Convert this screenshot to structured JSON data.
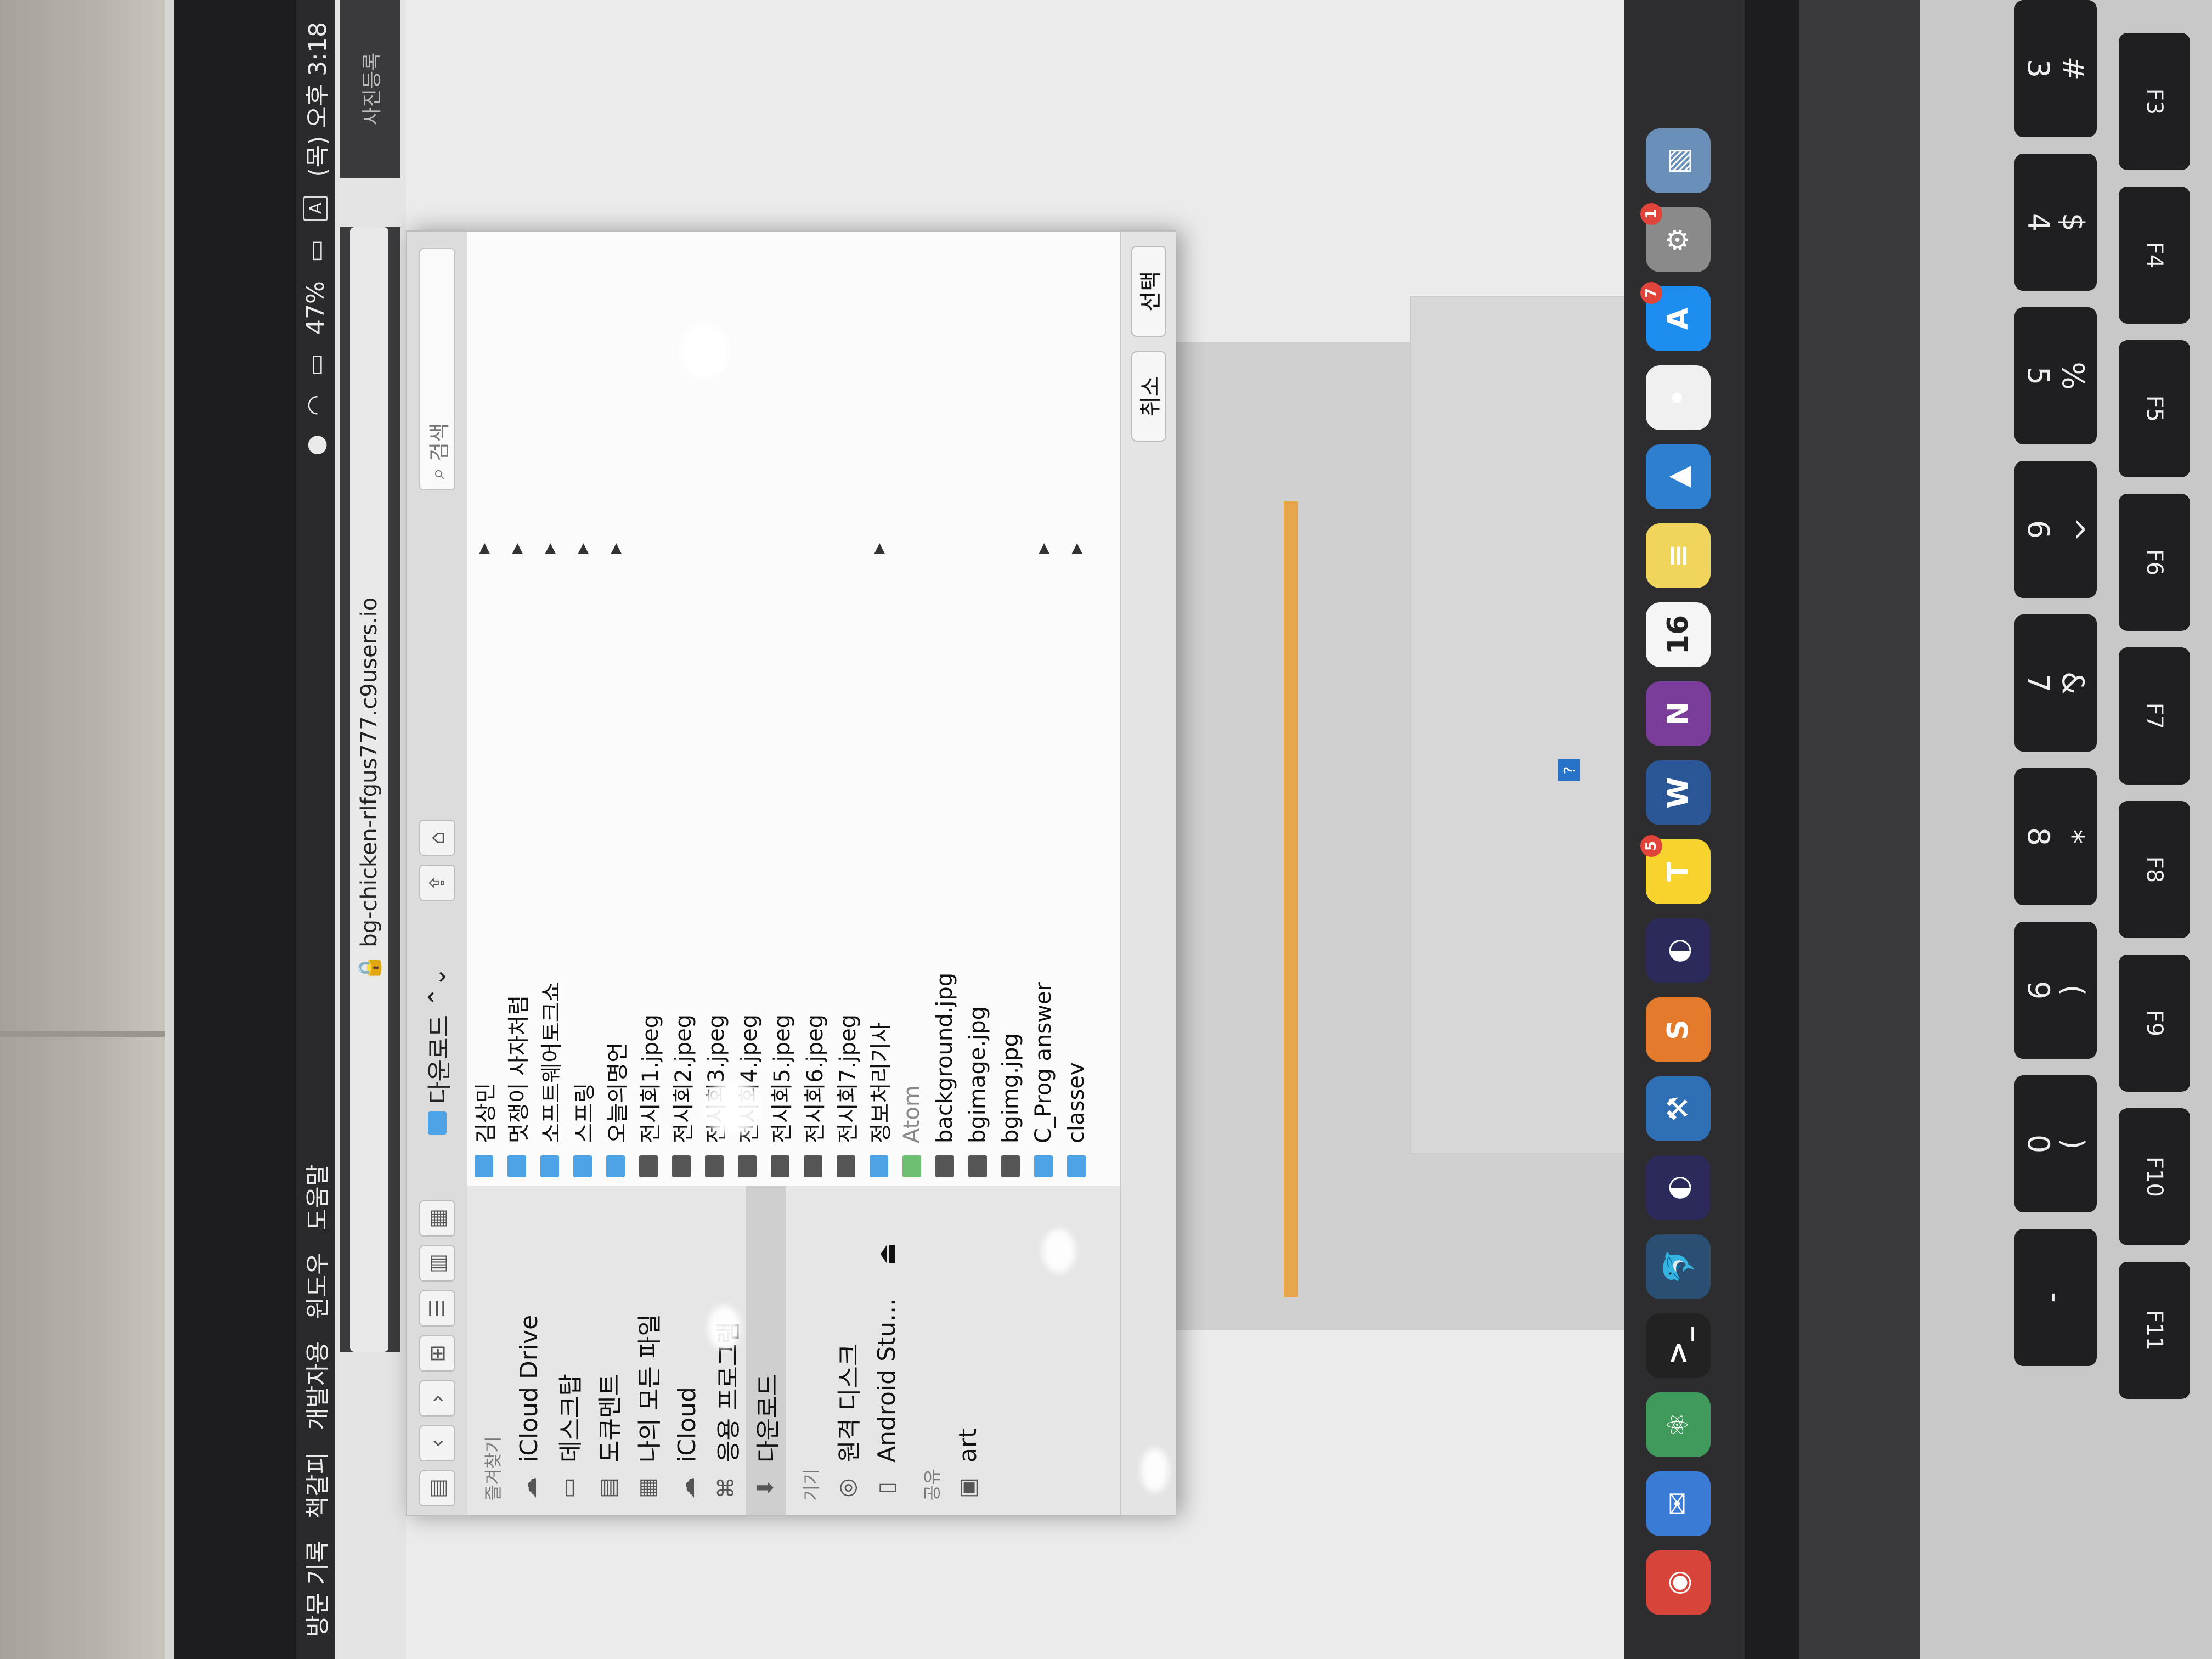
{
  "menubar": {
    "items": [
      "방문 기록",
      "책갈피",
      "개발자용",
      "윈도우",
      "도움말"
    ],
    "battery": "47%",
    "input_source": "A",
    "clock": "(목) 오후 3:18"
  },
  "browser": {
    "url": "bg-chicken-rlfgus777.c9users.io",
    "second_tab": "사진등록"
  },
  "dialog": {
    "location": "다운로드",
    "search_placeholder": "검색",
    "sidebar_heads": {
      "favorites": "즐겨찾기",
      "devices": "기기",
      "shared": "공유"
    },
    "favorites": [
      {
        "label": "iCloud Drive",
        "icon": "cloud-icon"
      },
      {
        "label": "데스크탑",
        "icon": "desktop-icon"
      },
      {
        "label": "도큐멘트",
        "icon": "document-icon"
      },
      {
        "label": "나의 모든 파일",
        "icon": "all-files-icon"
      },
      {
        "label": "iCloud",
        "icon": "cloud-icon"
      },
      {
        "label": "응용 프로그램",
        "icon": "applications-icon"
      },
      {
        "label": "다운로드",
        "icon": "download-icon"
      }
    ],
    "devices": [
      {
        "label": "원격 디스크",
        "icon": "disc-icon"
      },
      {
        "label": "Android Stu...",
        "icon": "drive-icon"
      }
    ],
    "shared": [
      {
        "label": "art",
        "icon": "computer-icon"
      }
    ],
    "files": [
      {
        "name": "김상민",
        "kind": "folder"
      },
      {
        "name": "멋쟁이 사자처럼",
        "kind": "folder"
      },
      {
        "name": "소프트웨어토크쇼",
        "kind": "folder"
      },
      {
        "name": "스프링",
        "kind": "folder"
      },
      {
        "name": "오늘의명언",
        "kind": "folder"
      },
      {
        "name": "전시회1.jpeg",
        "kind": "image"
      },
      {
        "name": "전시회2.jpeg",
        "kind": "image"
      },
      {
        "name": "전시회3.jpeg",
        "kind": "image"
      },
      {
        "name": "전시회4.jpeg",
        "kind": "image"
      },
      {
        "name": "전시회5.jpeg",
        "kind": "image"
      },
      {
        "name": "전시회6.jpeg",
        "kind": "image"
      },
      {
        "name": "전시회7.jpeg",
        "kind": "image"
      },
      {
        "name": "정보처리기사",
        "kind": "folder"
      },
      {
        "name": "Atom",
        "kind": "app"
      },
      {
        "name": "background.jpg",
        "kind": "image"
      },
      {
        "name": "bgimage.jpg",
        "kind": "image"
      },
      {
        "name": "bgimg.jpg",
        "kind": "image"
      },
      {
        "name": "C_Prog answer",
        "kind": "folder"
      },
      {
        "name": "classev",
        "kind": "folder"
      }
    ],
    "cancel_label": "취소",
    "select_label": "선택"
  },
  "dock": {
    "apps": [
      {
        "name": "Chrome",
        "icon": "chrome-icon",
        "color": "#d6443a"
      },
      {
        "name": "Mail",
        "icon": "mail-icon",
        "color": "#3a7bd5"
      },
      {
        "name": "Atom",
        "icon": "atom-icon",
        "color": "#3f9a5b"
      },
      {
        "name": "Terminal",
        "icon": "terminal-icon",
        "color": "#222222"
      },
      {
        "name": "MySQL Workbench",
        "icon": "dolphin-icon",
        "color": "#2b4f73"
      },
      {
        "name": "Eclipse",
        "icon": "eclipse-icon",
        "color": "#2c2a5a"
      },
      {
        "name": "Xcode",
        "icon": "xcode-icon",
        "color": "#2f6fb5"
      },
      {
        "name": "Sublime",
        "icon": "sublime-icon",
        "color": "#e47a2c"
      },
      {
        "name": "Eclipse",
        "icon": "eclipse-icon",
        "color": "#2c2a5a"
      },
      {
        "name": "KakaoTalk",
        "icon": "kakaotalk-icon",
        "color": "#f6d32d",
        "badge": "5"
      },
      {
        "name": "Word",
        "icon": "word-icon",
        "color": "#2b5797"
      },
      {
        "name": "OneNote",
        "icon": "onenote-icon",
        "color": "#7a3d9a"
      },
      {
        "name": "Calendar",
        "icon": "calendar-icon",
        "color": "#f5f5f5"
      },
      {
        "name": "Notes",
        "icon": "notes-icon",
        "color": "#f1d45b"
      },
      {
        "name": "Keynote",
        "icon": "keynote-icon",
        "color": "#2f7fd1"
      },
      {
        "name": "Reminders",
        "icon": "reminders-icon",
        "color": "#f0f0f0"
      },
      {
        "name": "App Store",
        "icon": "appstore-icon",
        "color": "#1d8ef0",
        "badge": "7"
      },
      {
        "name": "System Preferences",
        "icon": "gear-icon",
        "color": "#8a8a8a",
        "badge": "1"
      },
      {
        "name": "Preview",
        "icon": "preview-icon",
        "color": "#6a8fb8"
      }
    ],
    "calendar_day": "16"
  },
  "keyboard": {
    "fn_row": [
      "F3",
      "F4",
      "F5",
      "F6",
      "F7",
      "F8",
      "F9",
      "F10",
      "F11"
    ],
    "num_row": [
      "#\n3",
      "$\n4",
      "%\n5",
      "^\n6",
      "&\n7",
      "*\n8",
      "(\n9",
      ")\n0",
      "-"
    ]
  }
}
